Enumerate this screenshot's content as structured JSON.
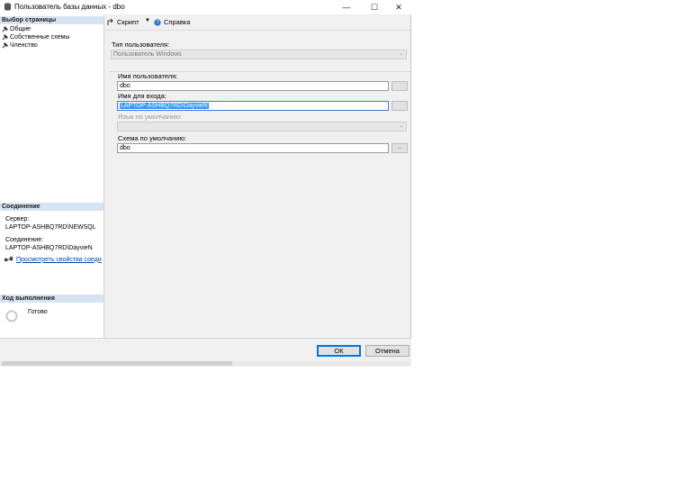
{
  "window": {
    "title": "Пользователь базы данных - dbo"
  },
  "left": {
    "select_page_header": "Выбор страницы",
    "pages": [
      {
        "label": "Общие"
      },
      {
        "label": "Собственные схемы"
      },
      {
        "label": "Членство"
      }
    ],
    "connection_header": "Соединение",
    "server_label": "Сервер:",
    "server_value": "LAPTOP-ASHBQ7RD\\NEWSQL",
    "connection_label": "Соединение:",
    "connection_value": "LAPTOP-ASHBQ7RD\\DayvieN",
    "view_link": "Просмотреть свойства соеди",
    "progress_header": "Ход выполнения",
    "progress_status": "Готово"
  },
  "toolbar": {
    "script_label": "Скрипт",
    "help_label": "Справка"
  },
  "form": {
    "user_type_label": "Тип пользователя:",
    "user_type_value": "Пользователь Windows",
    "user_name_label": "Имя пользователя:",
    "user_name_value": "dbo",
    "login_label": "Имя для входа:",
    "login_value": "LAPTOP-ASHBQ7RD\\DayvieN",
    "default_lang_label": "Язык по умолчанию:",
    "default_lang_value": "",
    "default_schema_label": "Схема по умолчанию:",
    "default_schema_value": "dbo",
    "browse_label": "..."
  },
  "buttons": {
    "ok": "ОК",
    "cancel": "Отмена"
  }
}
